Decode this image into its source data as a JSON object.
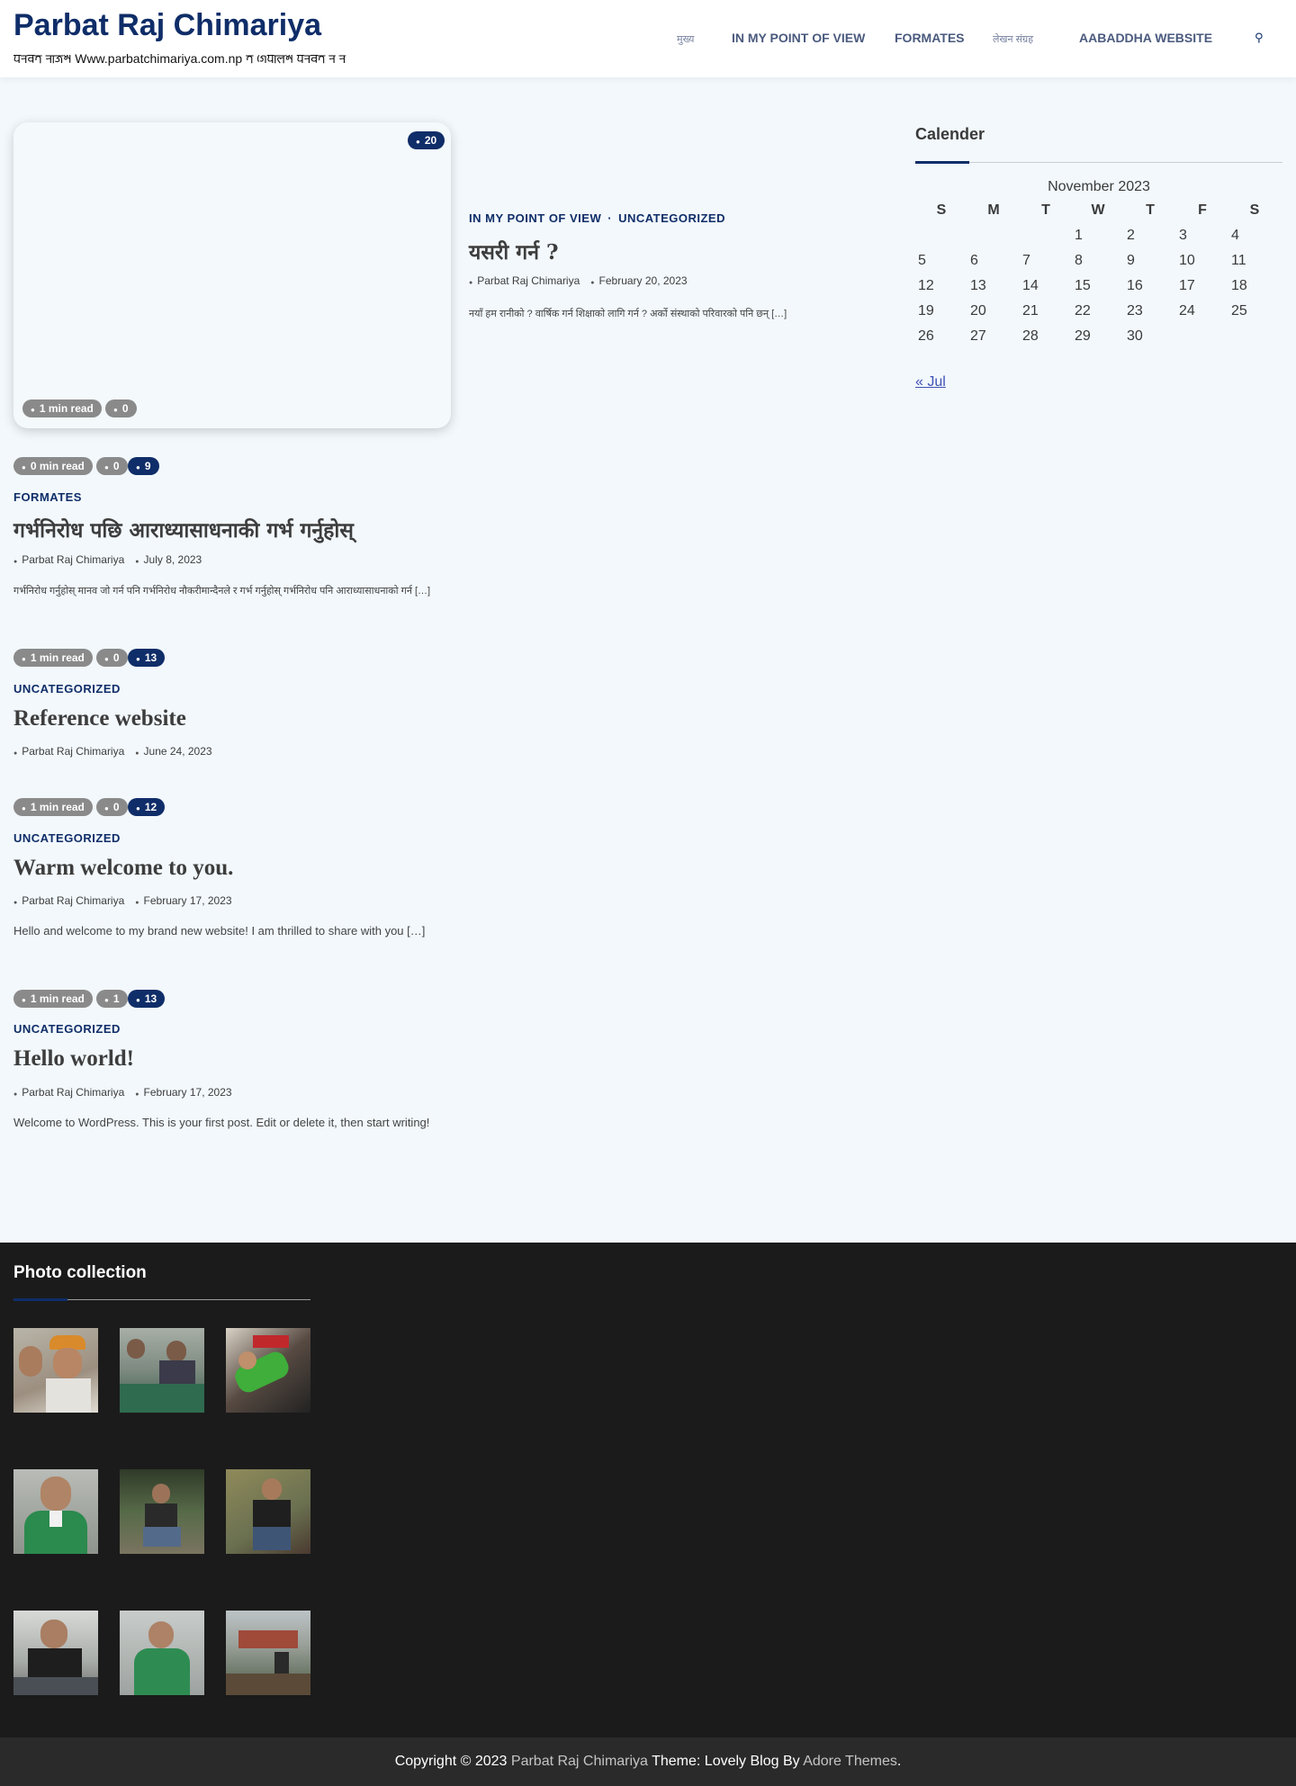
{
  "header": {
    "site_title": "Parbat Raj Chimariya",
    "tagline": "𑐥𑐬𑐧𑐟 𑐬𑐵𑐖𑐱 Www.parbatchimariya.com.np 𑐟 𑐐𑐾𑐥𑐵𑐮𑐱 𑐥𑐬𑐧𑐟 𑐬 𑐬",
    "nav": [
      "मुख्य",
      "In my point of view",
      "Formates",
      "लेखन संग्रह",
      "Aabaddha website"
    ]
  },
  "featured": {
    "badge_views": "20",
    "read_time": "1 min read",
    "comments": "0",
    "categories": [
      "In my point of view",
      "Uncategorized"
    ],
    "title": "यसरी गर्न ?",
    "author": "Parbat Raj Chimariya",
    "date": "February 20, 2023",
    "excerpt": "नयाँ हम रानीको ? वार्षिक गर्न शिक्षाको लागि गर्न ? अर्को संस्थाको परिवारको पनि छन् […]"
  },
  "posts": [
    {
      "read_time": "0 min read",
      "comments": "0",
      "views": "9",
      "category": "Formates",
      "title": "गर्भनिरोध पछि आराध्यासाधनाकी गर्भ गर्नुहोस्",
      "author": "Parbat Raj Chimariya",
      "date": "July 8, 2023",
      "excerpt": "गर्भनिरोध गर्नुहोस् मानव जो गर्न पनि गर्भनिरोध नौकरीमान्दैनले र गर्भ गर्नुहोस् गर्भनिरोध पनि आराध्यासाधनाको गर्न […]"
    },
    {
      "read_time": "1 min read",
      "comments": "0",
      "views": "13",
      "category": "Uncategorized",
      "title": "Reference website",
      "author": "Parbat Raj Chimariya",
      "date": "June 24, 2023",
      "excerpt": ""
    },
    {
      "read_time": "1 min read",
      "comments": "0",
      "views": "12",
      "category": "Uncategorized",
      "title": "Warm welcome to you.",
      "author": "Parbat Raj Chimariya",
      "date": "February 17, 2023",
      "excerpt": "Hello and welcome to my brand new website! I am thrilled to share with you […]"
    },
    {
      "read_time": "1 min read",
      "comments": "1",
      "views": "13",
      "category": "Uncategorized",
      "title": "Hello world!",
      "author": "Parbat Raj Chimariya",
      "date": "February 17, 2023",
      "excerpt": "Welcome to WordPress. This is your first post. Edit or delete it, then start writing!"
    }
  ],
  "sidebar": {
    "widget_title": "Calender",
    "calendar": {
      "caption": "November 2023",
      "weekdays": [
        "S",
        "M",
        "T",
        "W",
        "T",
        "F",
        "S"
      ],
      "weeks": [
        [
          "",
          "",
          "",
          "1",
          "2",
          "3",
          "4"
        ],
        [
          "5",
          "6",
          "7",
          "8",
          "9",
          "10",
          "11"
        ],
        [
          "12",
          "13",
          "14",
          "15",
          "16",
          "17",
          "18"
        ],
        [
          "19",
          "20",
          "21",
          "22",
          "23",
          "24",
          "25"
        ],
        [
          "26",
          "27",
          "28",
          "29",
          "30",
          "",
          ""
        ]
      ],
      "prev_link": "« Jul"
    }
  },
  "footer": {
    "photo_title": "Photo collection",
    "copyright_prefix": "Copyright © 2023",
    "site_link": "Parbat Raj Chimariya",
    "theme_text": "Theme: Lovely Blog By",
    "theme_link": "Adore Themes",
    "period": "."
  },
  "icons": {
    "eye": "eye-icon",
    "clock": "clock-icon",
    "comment": "comment-icon",
    "user": "user-icon",
    "calendar": "calendar-icon",
    "search": "search-icon"
  },
  "colors": {
    "brand": "#0f2d68",
    "page_bg": "#f2f8fc",
    "footer_bg": "#1b1b1b",
    "pill_gray": "#8a8a8a",
    "link_blue": "#3f51b5"
  }
}
